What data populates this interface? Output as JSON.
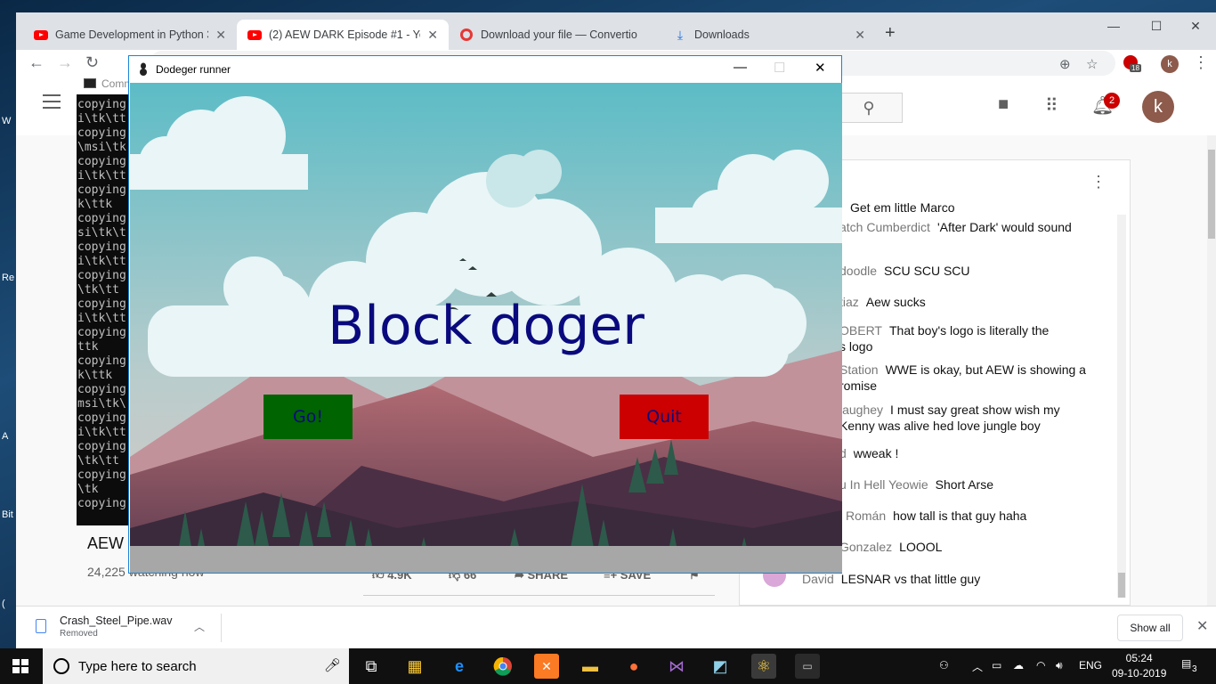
{
  "desktop": {
    "labels": [
      "W",
      "Re",
      "A",
      "Bit",
      "("
    ]
  },
  "browser": {
    "tabs": [
      {
        "title": "Game Development in Python 3",
        "icon": "youtube-icon"
      },
      {
        "title": "(2) AEW DARK Episode #1 - YouT",
        "icon": "youtube-icon"
      },
      {
        "title": "Download your file — Convertio",
        "icon": "convertio-icon"
      },
      {
        "title": "Downloads",
        "icon": "download-icon"
      }
    ],
    "profile_initial": "k",
    "extension_badge": "18"
  },
  "youtube": {
    "notifications": "2",
    "avatar_initial": "k",
    "video_title": "AEW",
    "views": "24,225 watching now",
    "actions": {
      "likes": "4.9K",
      "dislikes": "66",
      "share": "SHARE",
      "save": "SAVE"
    },
    "chat": [
      {
        "author": "",
        "text": "Get em little Marco"
      },
      {
        "author": "atch Cumberdict",
        "text": "'After Dark' would sound"
      },
      {
        "author": "doodle",
        "text": "SCU SCU SCU"
      },
      {
        "author": "tiaz",
        "text": "Aew sucks"
      },
      {
        "author": "OBERT",
        "text": "That boy's logo is literally the",
        "line2": "s logo"
      },
      {
        "author": "Station",
        "text": "WWE is okay, but AEW is showing a",
        "line2": "romise"
      },
      {
        "author": "laughey",
        "text": "I must say great show wish my",
        "line2": "Kenny was alive hed love jungle boy"
      },
      {
        "author": "d",
        "text": "wweak !"
      },
      {
        "author": "u In Hell Yeowie",
        "text": "Short Arse"
      },
      {
        "author": "l Román",
        "text": "how tall is that guy haha"
      },
      {
        "author": "Gonzalez",
        "text": "LOOOL"
      },
      {
        "author": "David",
        "text": "LESNAR vs that little guy"
      }
    ]
  },
  "downloads": {
    "file": "Crash_Steel_Pipe.wav",
    "status": "Removed",
    "show_all": "Show all"
  },
  "cmd": {
    "title": "Comm",
    "lines": [
      "copying",
      "i\\tk\\tt",
      "copying",
      "\\msi\\tk",
      "copying",
      "i\\tk\\tt",
      "copying",
      "k\\ttk",
      "copying",
      "si\\tk\\t",
      "copying",
      "i\\tk\\tt",
      "copying",
      "\\tk\\tt",
      "copying",
      "i\\tk\\tt",
      "copying",
      "ttk",
      "copying",
      "k\\ttk",
      "copying",
      "msi\\tk\\",
      "copying",
      "i\\tk\\tt",
      "copying",
      "\\tk\\tt",
      "copying",
      "\\tk",
      "copying"
    ]
  },
  "game": {
    "window_title": "Dodeger runner",
    "title": "Block doger",
    "go_label": "Go!",
    "quit_label": "Quit",
    "colors": {
      "go": "#006400",
      "quit": "#cc0000",
      "title": "#0a0a7e"
    }
  },
  "taskbar": {
    "search_placeholder": "Type here to search",
    "lang": "ENG",
    "time": "05:24",
    "date": "09-10-2019",
    "notif_count": "3"
  }
}
